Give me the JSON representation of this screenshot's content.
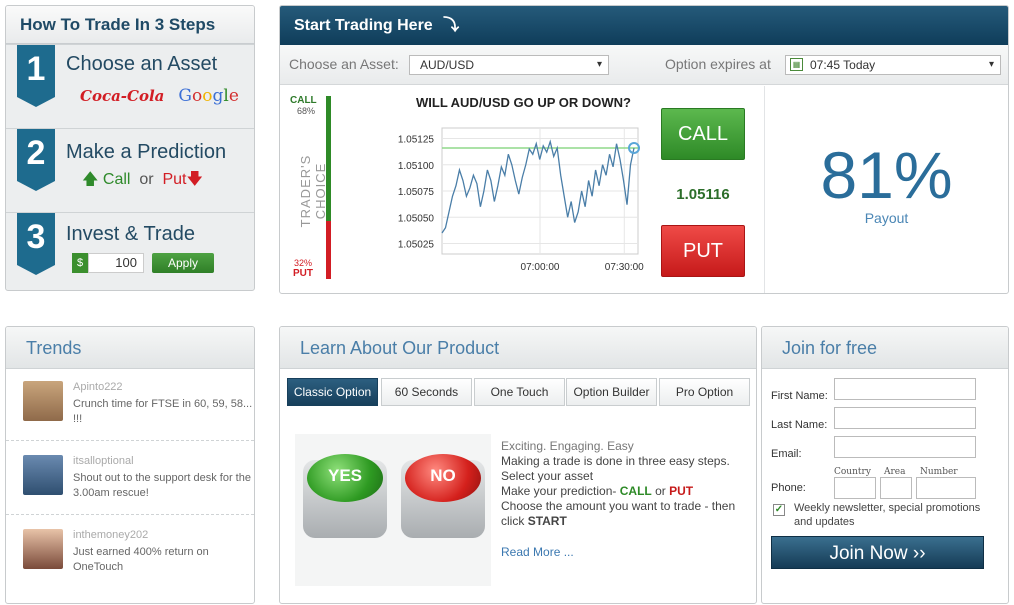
{
  "steps": {
    "title": "How To Trade In 3 Steps",
    "step1": {
      "num": "1",
      "label": "Choose an Asset",
      "brand1": "Coca-Cola",
      "brand2": "Google"
    },
    "step2": {
      "num": "2",
      "label": "Make a Prediction",
      "call": "Call",
      "or": "or",
      "put": "Put"
    },
    "step3": {
      "num": "3",
      "label": "Invest & Trade",
      "currency": "$",
      "amount": "100",
      "apply": "Apply"
    }
  },
  "trade": {
    "title": "Start Trading Here",
    "asset_label": "Choose an Asset:",
    "asset_value": "AUD/USD",
    "expires_label": "Option expires at",
    "expires_value": "07:45 Today",
    "call_label": "CALL",
    "call_pct": "68%",
    "choice_label": "TRADER'S CHOICE",
    "put_pct": "32%",
    "put_label": "PUT",
    "question": "WILL AUD/USD GO UP OR DOWN?",
    "call_button": "CALL",
    "put_button": "PUT",
    "price": "1.05116",
    "payout_pct": "81%",
    "payout_label": "Payout"
  },
  "chart_data": {
    "type": "line",
    "title": "WILL AUD/USD GO UP OR DOWN?",
    "yticks": [
      "1.05125",
      "1.05100",
      "1.05075",
      "1.05050",
      "1.05025"
    ],
    "xticks": [
      "07:00:00",
      "07:30:00"
    ],
    "ylim": [
      1.05015,
      1.05135
    ],
    "threshold": 1.05116,
    "values": [
      1.05035,
      1.0504,
      1.05055,
      1.0507,
      1.0508,
      1.05095,
      1.05085,
      1.0507,
      1.05078,
      1.0509,
      1.05082,
      1.0506,
      1.05075,
      1.05095,
      1.05085,
      1.05065,
      1.0508,
      1.05098,
      1.0509,
      1.0511,
      1.051,
      1.05085,
      1.05072,
      1.05088,
      1.051,
      1.05115,
      1.0511,
      1.0512,
      1.05105,
      1.05118,
      1.05112,
      1.05122,
      1.05108,
      1.05116,
      1.0509,
      1.0507,
      1.0505,
      1.05065,
      1.05045,
      1.05055,
      1.05075,
      1.0506,
      1.05085,
      1.0507,
      1.05095,
      1.0508,
      1.051,
      1.0509,
      1.0511,
      1.05098,
      1.0512,
      1.05105,
      1.05085,
      1.05062,
      1.051,
      1.05116
    ]
  },
  "trends": {
    "title": "Trends",
    "items": [
      {
        "name": "Apinto222",
        "msg": "Crunch time for FTSE in 60, 59, 58... !!!"
      },
      {
        "name": "itsalloptional",
        "msg": "Shout out to the support desk for the 3.00am rescue!"
      },
      {
        "name": "inthemoney202",
        "msg": "Just earned 400% return on OneTouch"
      }
    ]
  },
  "learn": {
    "title": "Learn About Our Product",
    "tabs": [
      "Classic Option",
      "60 Seconds",
      "One Touch",
      "Option Builder",
      "Pro Option"
    ],
    "yes": "YES",
    "no": "NO",
    "line1": "Exciting. Engaging. Easy",
    "line2": "Making a trade is done in three easy steps.",
    "line3": "Select your asset",
    "line4a": "Make your prediction-",
    "call": "CALL",
    "or": "or",
    "put": "PUT",
    "line5": "Choose the amount you want to trade - then click",
    "start": "START",
    "readmore": "Read More ..."
  },
  "join": {
    "title": "Join for free",
    "first": "First Name:",
    "last": "Last Name:",
    "email": "Email:",
    "phone": "Phone:",
    "country": "Country",
    "area": "Area",
    "number": "Number",
    "newsletter": "Weekly newsletter, special promotions and updates",
    "button": "Join Now ››"
  }
}
